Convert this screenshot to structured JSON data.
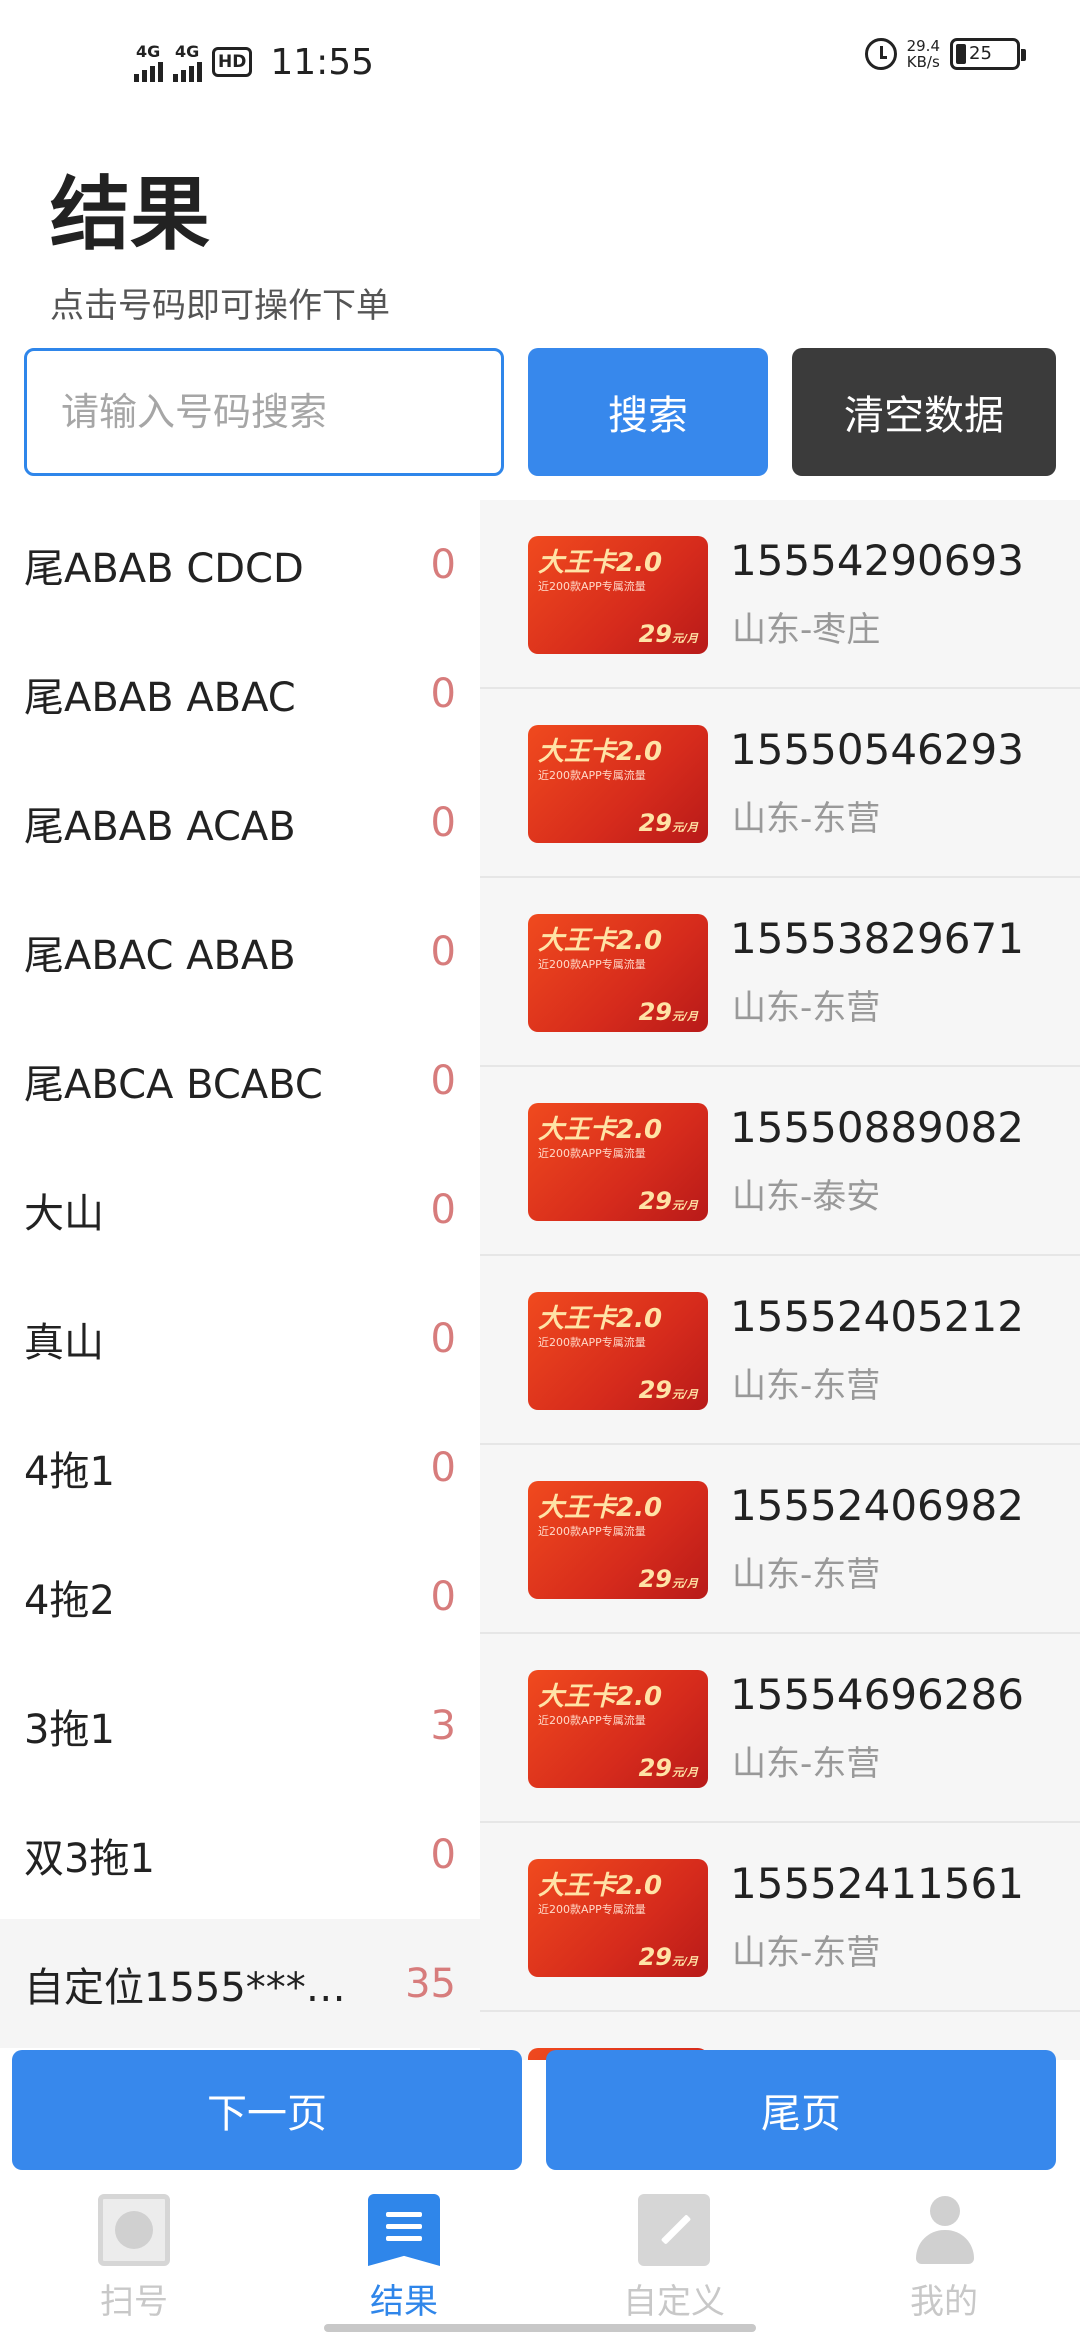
{
  "status_bar": {
    "net1": "4G",
    "net2": "4G",
    "hd": "HD",
    "time": "11:55",
    "speed_value": "29.4",
    "speed_unit": "KB/s",
    "battery": "25"
  },
  "header": {
    "title": "结果",
    "subtitle": "点击号码即可操作下单"
  },
  "search": {
    "placeholder": "请输入号码搜索",
    "value": "",
    "search_label": "搜索",
    "clear_label": "清空数据"
  },
  "categories": [
    {
      "name": "尾ABAB CDCD",
      "count": "0"
    },
    {
      "name": "尾ABAB ABAC",
      "count": "0"
    },
    {
      "name": "尾ABAB ACAB",
      "count": "0"
    },
    {
      "name": "尾ABAC ABAB",
      "count": "0"
    },
    {
      "name": "尾ABCA BCABC",
      "count": "0"
    },
    {
      "name": "大山",
      "count": "0"
    },
    {
      "name": "真山",
      "count": "0"
    },
    {
      "name": "4拖1",
      "count": "0"
    },
    {
      "name": "4拖2",
      "count": "0"
    },
    {
      "name": "3拖1",
      "count": "3"
    },
    {
      "name": "双3拖1",
      "count": "0"
    },
    {
      "name": "自定位1555***…",
      "count": "35"
    }
  ],
  "card": {
    "title": "大王卡2.0",
    "subtitle": "近200款APP专属流量",
    "price": "29",
    "price_unit": "元/月"
  },
  "results": [
    {
      "number": "15554290693",
      "location": "山东-枣庄"
    },
    {
      "number": "15550546293",
      "location": "山东-东营"
    },
    {
      "number": "15553829671",
      "location": "山东-东营"
    },
    {
      "number": "15550889082",
      "location": "山东-泰安"
    },
    {
      "number": "15552405212",
      "location": "山东-东营"
    },
    {
      "number": "15552406982",
      "location": "山东-东营"
    },
    {
      "number": "15554696286",
      "location": "山东-东营"
    },
    {
      "number": "15552411561",
      "location": "山东-东营"
    }
  ],
  "pager": {
    "next_label": "下一页",
    "last_label": "尾页"
  },
  "tabs": [
    {
      "label": "扫号",
      "icon": "scan-icon",
      "active": false
    },
    {
      "label": "结果",
      "icon": "result-icon",
      "active": true
    },
    {
      "label": "自定义",
      "icon": "edit-icon",
      "active": false
    },
    {
      "label": "我的",
      "icon": "user-icon",
      "active": false
    }
  ],
  "colors": {
    "accent": "#3788ec",
    "dark_button": "#3b3b3b",
    "count_color": "#d77c7c",
    "card_red": "#e0331d"
  }
}
